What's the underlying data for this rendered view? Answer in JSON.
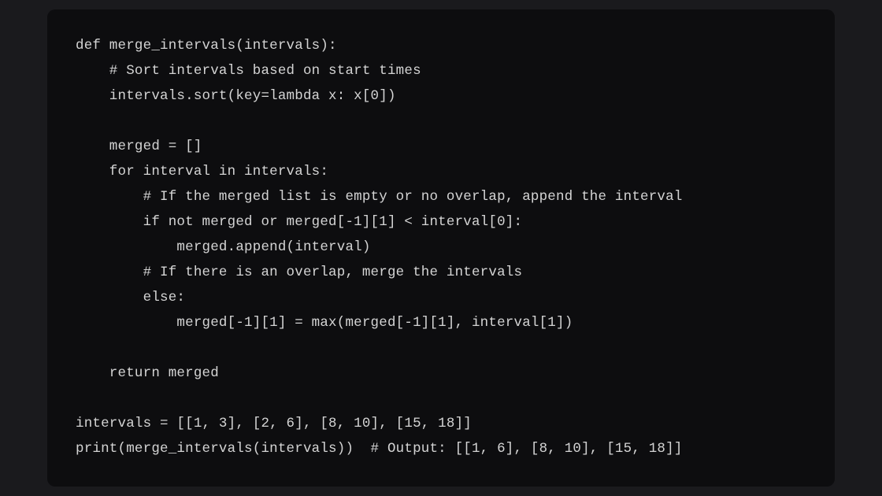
{
  "code": {
    "language": "python",
    "lines": [
      "def merge_intervals(intervals):",
      "    # Sort intervals based on start times",
      "    intervals.sort(key=lambda x: x[0])",
      "",
      "    merged = []",
      "    for interval in intervals:",
      "        # If the merged list is empty or no overlap, append the interval",
      "        if not merged or merged[-1][1] < interval[0]:",
      "            merged.append(interval)",
      "        # If there is an overlap, merge the intervals",
      "        else:",
      "            merged[-1][1] = max(merged[-1][1], interval[1])",
      "",
      "    return merged",
      "",
      "intervals = [[1, 3], [2, 6], [8, 10], [15, 18]]",
      "print(merge_intervals(intervals))  # Output: [[1, 6], [8, 10], [15, 18]]"
    ]
  }
}
